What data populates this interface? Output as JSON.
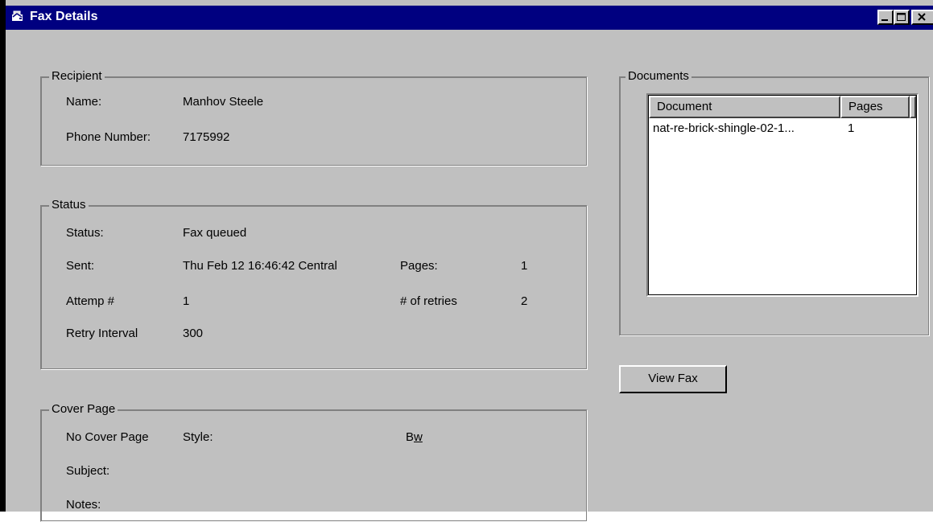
{
  "window": {
    "title": "Fax Details",
    "controls": {
      "minimize": "_",
      "maximize": "□",
      "close": "×"
    }
  },
  "recipient": {
    "legend": "Recipient",
    "name_label": "Name:",
    "name_value": "Manhov Steele",
    "phone_label": "Phone Number:",
    "phone_value": "7175992"
  },
  "status": {
    "legend": "Status",
    "status_label": "Status:",
    "status_value": "Fax queued",
    "sent_label": "Sent:",
    "sent_value": "Thu Feb 12 16:46:42 Central",
    "pages_label": "Pages:",
    "pages_value": "1",
    "attempt_label": "Attemp #",
    "attempt_value": "1",
    "retries_label": "# of retries",
    "retries_value": "2",
    "retry_interval_label": "Retry Interval",
    "retry_interval_value": "300"
  },
  "cover_page": {
    "legend": "Cover Page",
    "no_cover_label": "No Cover Page",
    "style_label": "Style:",
    "style_value_prefix": "B",
    "style_value_underlined": "w",
    "subject_label": "Subject:",
    "notes_label": "Notes:"
  },
  "documents": {
    "legend": "Documents",
    "columns": [
      "Document",
      "Pages"
    ],
    "rows": [
      {
        "document": "nat-re-brick-shingle-02-1...",
        "pages": "1"
      }
    ]
  },
  "actions": {
    "view_fax_label": "View Fax"
  }
}
